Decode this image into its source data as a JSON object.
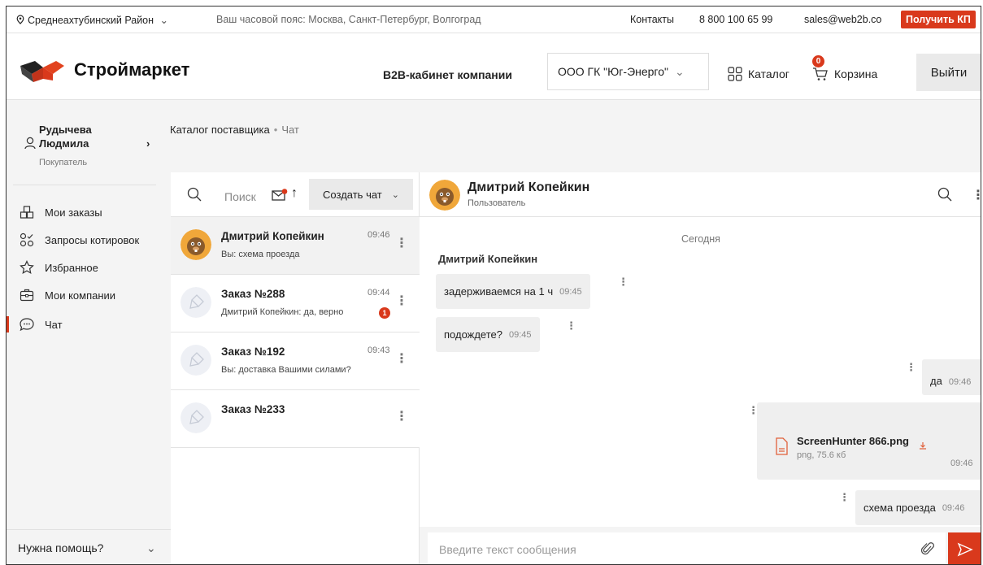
{
  "topbar": {
    "region": "Среднеахтубинский Район",
    "timezone": "Ваш часовой пояс: Москва, Санкт-Петербург, Волгоград",
    "contacts": "Контакты",
    "phone": "8 800 100 65 99",
    "email": "sales@web2b.co",
    "kp_button": "Получить КП"
  },
  "header": {
    "logo_text": "Строймаркет",
    "b2b_label": "B2B-кабинет компании",
    "company": "ООО ГК \"Юг-Энерго\"",
    "catalog": "Каталог",
    "cart": "Корзина",
    "cart_count": "0",
    "logout": "Выйти"
  },
  "user": {
    "first_line": "Рудычева",
    "second_line": "Людмила",
    "role": "Покупатель"
  },
  "breadcrumb": {
    "parent": "Каталог поставщика",
    "separator": "•",
    "current": "Чат"
  },
  "sidebar": {
    "items": [
      {
        "label": "Мои заказы",
        "icon": "boxes-icon"
      },
      {
        "label": "Запросы котировок",
        "icon": "quotes-icon"
      },
      {
        "label": "Избранное",
        "icon": "star-icon"
      },
      {
        "label": "Мои компании",
        "icon": "briefcase-icon"
      },
      {
        "label": "Чат",
        "icon": "chat-icon"
      }
    ],
    "active": "Чат",
    "help": "Нужна помощь?"
  },
  "chat_list": {
    "search_placeholder": "Поиск",
    "create_chat": "Создать чат",
    "items": [
      {
        "title": "Дмитрий Копейкин",
        "subtitle": "Вы: схема проезда",
        "time": "09:46"
      },
      {
        "title": "Заказ №288",
        "subtitle": "Дмитрий Копейкин: да, верно",
        "time": "09:44",
        "badge": "1"
      },
      {
        "title": "Заказ №192",
        "subtitle": "Вы: доставка Вашими силами?",
        "time": "09:43"
      },
      {
        "title": "Заказ №233",
        "subtitle": "",
        "time": ""
      }
    ]
  },
  "chat": {
    "name": "Дмитрий Копейкин",
    "role": "Пользователь",
    "date_separator": "Сегодня",
    "sender": "Дмитрий Копейкин",
    "messages": [
      {
        "text": "задерживаемся на 1 ч",
        "time": "09:45"
      },
      {
        "text": "подождете?",
        "time": "09:45"
      },
      {
        "text": "да",
        "time": "09:46"
      },
      {
        "text": "схема проезда",
        "time": "09:46"
      }
    ],
    "file": {
      "name": "ScreenHunter 866.png",
      "meta": "png, 75.6 кб",
      "time": "09:46"
    },
    "composer_placeholder": "Введите текст сообщения"
  },
  "colors": {
    "accent": "#d9391c",
    "panel": "#f4f4f4",
    "bubble": "#efefef"
  }
}
